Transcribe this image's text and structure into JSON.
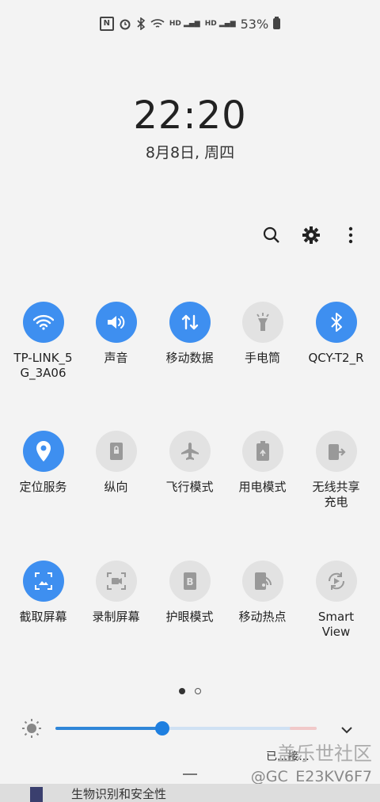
{
  "status": {
    "battery": "53%"
  },
  "clock": {
    "time": "22:20",
    "date": "8月8日, 周四"
  },
  "top_icons": [
    "search-icon",
    "gear-icon",
    "more-vertical-icon"
  ],
  "tiles": [
    {
      "label": "TP-LINK_5\nG_3A06",
      "icon": "wifi-icon",
      "on": true
    },
    {
      "label": "声音",
      "icon": "volume-icon",
      "on": true
    },
    {
      "label": "移动数据",
      "icon": "data-arrows-icon",
      "on": true
    },
    {
      "label": "手电筒",
      "icon": "flashlight-icon",
      "on": false
    },
    {
      "label": "QCY-T2_R",
      "icon": "bluetooth-icon",
      "on": true
    },
    {
      "label": "定位服务",
      "icon": "location-icon",
      "on": true
    },
    {
      "label": "纵向",
      "icon": "portrait-lock-icon",
      "on": false
    },
    {
      "label": "飞行模式",
      "icon": "airplane-icon",
      "on": false
    },
    {
      "label": "用电模式",
      "icon": "power-mode-icon",
      "on": false
    },
    {
      "label": "无线共享\n充电",
      "icon": "wireless-share-icon",
      "on": false
    },
    {
      "label": "截取屏幕",
      "icon": "screenshot-icon",
      "on": true
    },
    {
      "label": "录制屏幕",
      "icon": "screen-record-icon",
      "on": false
    },
    {
      "label": "护眼模式",
      "icon": "eye-comfort-icon",
      "on": false
    },
    {
      "label": "移动热点",
      "icon": "hotspot-icon",
      "on": false
    },
    {
      "label": "Smart\nView",
      "icon": "smart-view-icon",
      "on": false
    }
  ],
  "brightness": {
    "level": 0.41
  },
  "footer": {
    "status_text": "已...接...",
    "watermark_a": "盖乐世社区",
    "watermark_b": "@GC_E23KV6F7",
    "behind_text": "生物识别和安全性"
  },
  "colors": {
    "accent": "#3e8ff0",
    "tile_off": "#e2e2e2"
  }
}
